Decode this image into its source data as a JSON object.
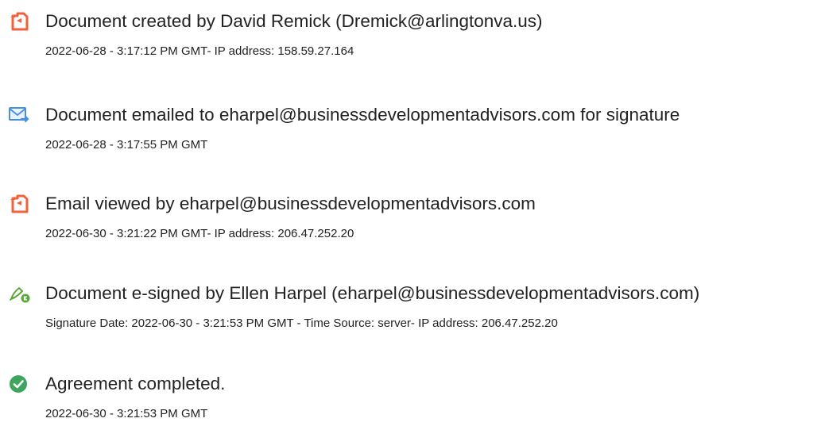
{
  "colors": {
    "created_icon": "#f0623a",
    "emailed_icon": "#4a90e2",
    "signed_icon": "#5ba83a",
    "completed_icon": "#3ea55d"
  },
  "events": [
    {
      "icon": "document-created-icon",
      "title": "Document created by David Remick (Dremick@arlingtonva.us)",
      "detail": "2022-06-28 - 3:17:12 PM GMT- IP address: 158.59.27.164"
    },
    {
      "icon": "envelope-send-icon",
      "title": "Document emailed to eharpel@businessdevelopmentadvisors.com for signature",
      "detail": "2022-06-28 - 3:17:55 PM GMT"
    },
    {
      "icon": "document-viewed-icon",
      "title": "Email viewed by eharpel@businessdevelopmentadvisors.com",
      "detail": "2022-06-30 - 3:21:22 PM GMT- IP address: 206.47.252.20"
    },
    {
      "icon": "e-sign-pen-icon",
      "title": "Document e-signed by Ellen Harpel (eharpel@businessdevelopmentadvisors.com)",
      "detail": "Signature Date: 2022-06-30 - 3:21:53 PM GMT - Time Source: server- IP address: 206.47.252.20"
    },
    {
      "icon": "checkmark-circle-icon",
      "title": "Agreement completed.",
      "detail": "2022-06-30 - 3:21:53 PM GMT"
    }
  ]
}
